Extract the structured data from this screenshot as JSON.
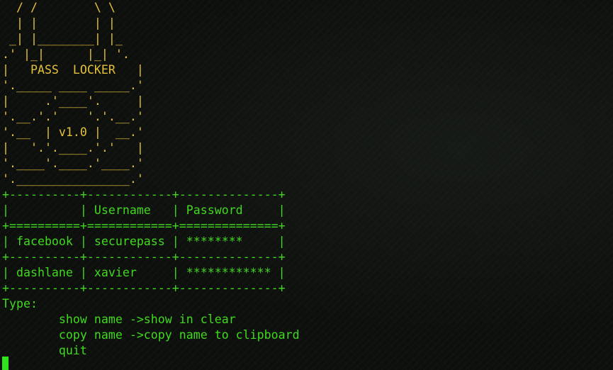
{
  "theme": {
    "art_color": "#e5c13b",
    "text_color": "#41d91f",
    "cursor_color": "#2fe31d",
    "background": "#0d0f0d"
  },
  "banner": {
    "lines": [
      "  / /        \\ \\",
      "  | |        | |",
      " _| |________| |_",
      ".' |_|      |_| '.",
      "|   PASS  LOCKER   |",
      "'._____ ____ _____.'",
      "|     .'____'.     |",
      "'.__.'.'    '.'.__.'",
      "'.__  | v1.0 |  __.'",
      "|   '.'.____.'.'   |",
      "'.____'.____.'____.'",
      "'.________________.'"
    ]
  },
  "table": {
    "lines": [
      "+----------+------------+--------------+",
      "|          | Username   | Password     |",
      "+==========+============+==============+",
      "| facebook | securepass | ********     |",
      "+----------+------------+--------------+",
      "| dashlane | xavier     | ************ |",
      "+----------+------------+--------------+"
    ]
  },
  "help": {
    "title": "Type:",
    "commands": [
      "        show name ->show in clear",
      "        copy name ->copy name to clipboard",
      "        quit"
    ]
  }
}
